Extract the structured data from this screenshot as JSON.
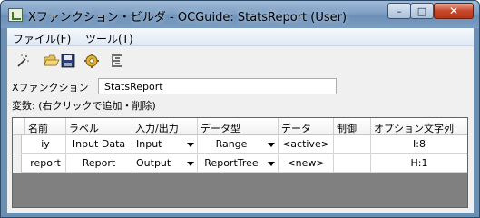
{
  "window": {
    "title": "Xファンクション・ビルダ - OCGuide: StatsReport (User)",
    "controls": {
      "minimize": "–",
      "maximize": "□",
      "close": "✕"
    }
  },
  "menu": {
    "items": [
      "ファイル(F)",
      "ツール(T)"
    ]
  },
  "toolbar": {
    "icons": [
      "wand-icon",
      "open-folder-icon",
      "save-icon",
      "gear-icon",
      "tree-view-icon"
    ]
  },
  "xfunction": {
    "label": "Xファンクション",
    "value": "StatsReport"
  },
  "variables": {
    "label": "変数: (右クリックで追加・削除)"
  },
  "grid": {
    "columns": [
      "名前",
      "ラベル",
      "入力/出力",
      "データ型",
      "データ",
      "制御",
      "オプション文字列"
    ],
    "rows": [
      [
        "iy",
        "Input Data",
        "Input",
        "Range",
        "<active>",
        "",
        "I:8"
      ],
      [
        "report",
        "Report",
        "Output",
        "ReportTree",
        "<new>",
        "",
        "H:1"
      ]
    ]
  },
  "colors": {
    "title_bar": "#7e9fc4",
    "client_bg": "#f0f0f0",
    "grid_bg": "#808080",
    "close_button": "#c8472b"
  }
}
